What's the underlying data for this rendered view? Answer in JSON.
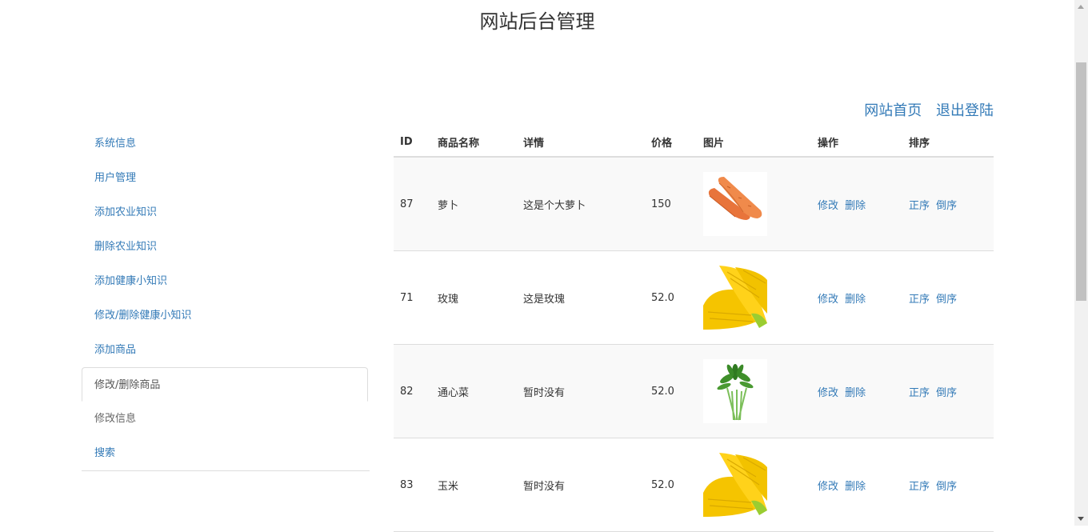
{
  "header": {
    "title": "网站后台管理"
  },
  "top_links": {
    "home": "网站首页",
    "logout": "退出登陆"
  },
  "sidebar": {
    "items": [
      {
        "label": "系统信息"
      },
      {
        "label": "用户管理"
      },
      {
        "label": "添加农业知识"
      },
      {
        "label": "删除农业知识"
      },
      {
        "label": "添加健康小知识"
      },
      {
        "label": "修改/删除健康小知识"
      },
      {
        "label": "添加商品"
      },
      {
        "label": "修改/删除商品"
      },
      {
        "label": "修改信息"
      },
      {
        "label": "搜索"
      }
    ]
  },
  "table": {
    "headers": [
      "ID",
      "商品名称",
      "详情",
      "价格",
      "图片",
      "操作",
      "排序"
    ],
    "edit_label": "修改",
    "delete_label": "删除",
    "asc_label": "正序",
    "desc_label": "倒序",
    "rows": [
      {
        "id": "87",
        "name": "萝卜",
        "detail": "这是个大萝卜",
        "price": "150",
        "image": "carrot"
      },
      {
        "id": "71",
        "name": "玫瑰",
        "detail": "这是玫瑰",
        "price": "52.0",
        "image": "corn"
      },
      {
        "id": "82",
        "name": "通心菜",
        "detail": "暂时没有",
        "price": "52.0",
        "image": "water-spinach"
      },
      {
        "id": "83",
        "name": "玉米",
        "detail": "暂时没有",
        "price": "52.0",
        "image": "corn"
      }
    ]
  }
}
